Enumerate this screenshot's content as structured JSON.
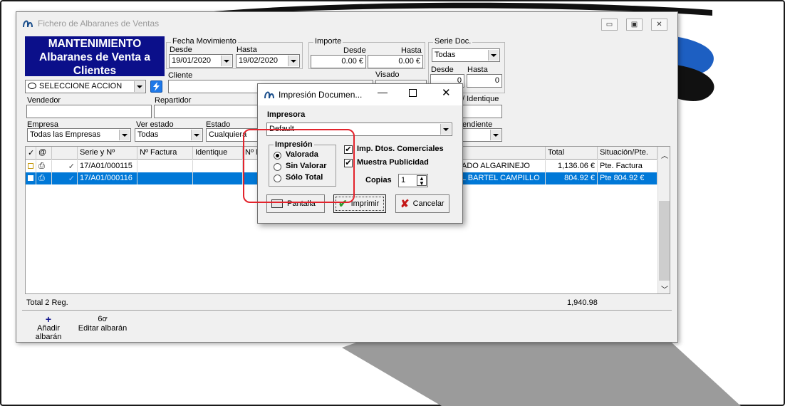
{
  "window": {
    "title": "Fichero de Albaranes de Ventas",
    "minimize_glyph": "▭",
    "restore_glyph": "▣",
    "close_glyph": "✕"
  },
  "header": {
    "box_title_line1": "MANTENIMIENTO",
    "box_title_line2": "Albaranes de Venta a",
    "box_title_line3": "Clientes",
    "accion_value": "SELECCIONE ACCION"
  },
  "filters": {
    "fecha_group": "Fecha Movimiento",
    "desde_label": "Desde",
    "hasta_label": "Hasta",
    "fecha_desde": "19/01/2020",
    "fecha_hasta": "19/02/2020",
    "importe_group": "Importe",
    "importe_desde_label": "Desde",
    "importe_hasta_label": "Hasta",
    "importe_desde": "0.00 €",
    "importe_hasta": "0.00 €",
    "serie_group": "Serie Doc.",
    "serie_value": "Todas",
    "serie_desde_label": "Desde",
    "serie_hasta_label": "Hasta",
    "serie_desde": "0",
    "serie_hasta": "0",
    "cliente_label": "Cliente",
    "visado_label": "Visado",
    "identique_label": "/ Identique",
    "vendedor_label": "Vendedor",
    "repartidor_label": "Repartidor",
    "empresa_label": "Empresa",
    "empresa_value": "Todas las Empresas",
    "ver_estado_label": "Ver estado",
    "ver_estado_value": "Todas",
    "estado_label": "Estado",
    "estado_value": "Cualquiera",
    "pendiente_label": "endiente"
  },
  "grid": {
    "headers": [
      "✓",
      "@",
      "Serie y Nº",
      "Nº Factura",
      "Identique",
      "Nº M",
      "Total",
      "Situación/Pte."
    ],
    "rows": [
      {
        "serie": "17/A01/000115",
        "cliente": "ADO ALGARINEJO",
        "total": "1,136.06 €",
        "situacion": "Pte. Factura"
      },
      {
        "serie": "17/A01/000116",
        "cliente": "L BARTEL CAMPILLO",
        "total": "804.92 €",
        "situacion": "Pte 804.92 €"
      }
    ],
    "total_label": "Total 2 Reg.",
    "total_value": "1,940.98"
  },
  "toolbar": {
    "add_label": "Añadir albarán",
    "edit_label": "Editar albarán",
    "edit_glyph": "6ơ"
  },
  "dialog": {
    "title": "Impresión Documen...",
    "impresora_label": "Impresora",
    "impresora_value": "Default",
    "impresion_group": "Impresión",
    "opt_valorada": "Valorada",
    "opt_sin_valorar": "Sin Valorar",
    "opt_solo_total": "Sólo Total",
    "chk_imp_dtos": "Imp. Dtos. Comerciales",
    "chk_publicidad": "Muestra Publicidad",
    "copias_label": "Copias",
    "copias_value": "1",
    "btn_pantalla": "Pantalla",
    "btn_imprimir": "Imprimir",
    "btn_cancelar": "Cancelar"
  },
  "colors": {
    "accent_blue": "#0b0f8a",
    "selection": "#0078d7",
    "annotation_red": "#e3232c"
  }
}
